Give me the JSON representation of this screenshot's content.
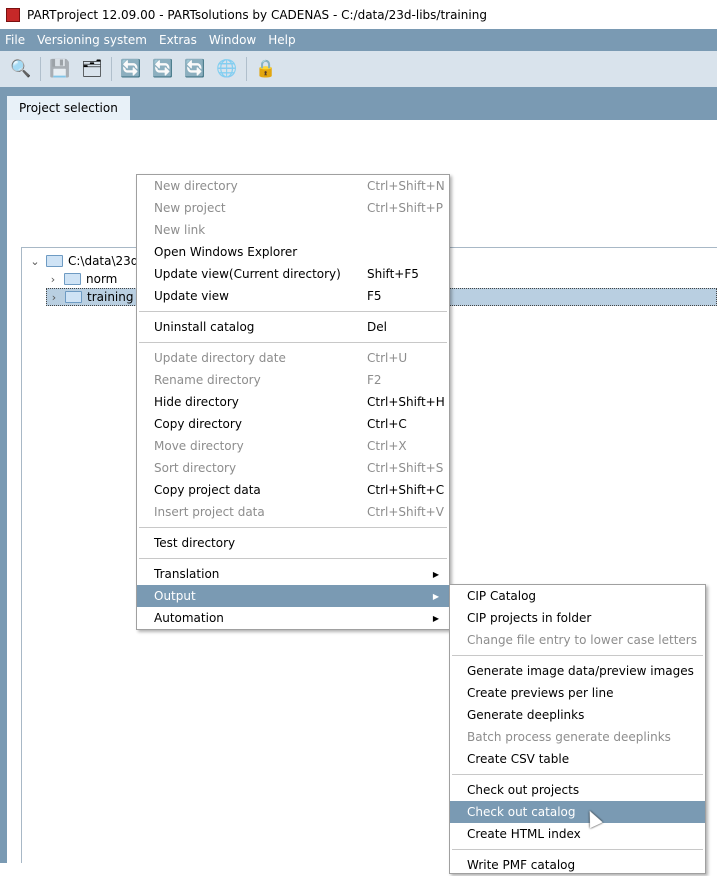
{
  "title": "PARTproject 12.09.00 - PARTsolutions by CADENAS - C:/data/23d-libs/training",
  "menubar": [
    "File",
    "Versioning system",
    "Extras",
    "Window",
    "Help"
  ],
  "toolbar": [
    "search-text-icon",
    "save-icon",
    "save-all-icon",
    "update-1-icon",
    "update-2-icon",
    "update-3-icon",
    "globe-icon",
    "lock-search-icon"
  ],
  "tab": "Project selection",
  "tree": {
    "root": "C:\\data\\23d-libs",
    "children": [
      "norm",
      "training"
    ]
  },
  "context_menu": [
    {
      "label": "New directory",
      "shortcut": "Ctrl+Shift+N",
      "disabled": true
    },
    {
      "label": "New project",
      "shortcut": "Ctrl+Shift+P",
      "disabled": true
    },
    {
      "label": "New link",
      "shortcut": "",
      "disabled": true
    },
    {
      "label": "Open Windows Explorer",
      "shortcut": ""
    },
    {
      "label": "Update view(Current directory)",
      "shortcut": "Shift+F5"
    },
    {
      "label": "Update view",
      "shortcut": "F5"
    },
    {
      "sep": true
    },
    {
      "label": "Uninstall catalog",
      "shortcut": "Del"
    },
    {
      "sep": true
    },
    {
      "label": "Update directory date",
      "shortcut": "Ctrl+U",
      "disabled": true
    },
    {
      "label": "Rename directory",
      "shortcut": "F2",
      "disabled": true
    },
    {
      "label": "Hide directory",
      "shortcut": "Ctrl+Shift+H"
    },
    {
      "label": "Copy directory",
      "shortcut": "Ctrl+C"
    },
    {
      "label": "Move directory",
      "shortcut": "Ctrl+X",
      "disabled": true
    },
    {
      "label": "Sort directory",
      "shortcut": "Ctrl+Shift+S",
      "disabled": true
    },
    {
      "label": "Copy project data",
      "shortcut": "Ctrl+Shift+C"
    },
    {
      "label": "Insert project data",
      "shortcut": "Ctrl+Shift+V",
      "disabled": true
    },
    {
      "sep": true
    },
    {
      "label": "Test directory",
      "shortcut": ""
    },
    {
      "sep": true
    },
    {
      "label": "Translation",
      "submenu": true
    },
    {
      "label": "Output",
      "submenu": true,
      "highlighted": true
    },
    {
      "label": "Automation",
      "submenu": true
    }
  ],
  "submenu": [
    {
      "label": "CIP Catalog"
    },
    {
      "label": "CIP projects in folder"
    },
    {
      "label": "Change file entry to lower case letters",
      "disabled": true
    },
    {
      "sep": true
    },
    {
      "label": "Generate image data/preview images"
    },
    {
      "label": "Create previews per line"
    },
    {
      "label": "Generate deeplinks"
    },
    {
      "label": "Batch process generate deeplinks",
      "disabled": true
    },
    {
      "label": "Create CSV table"
    },
    {
      "sep": true
    },
    {
      "label": "Check out projects"
    },
    {
      "label": "Check out catalog",
      "highlighted": true
    },
    {
      "label": "Create HTML index"
    },
    {
      "sep": true
    },
    {
      "label": "Write PMF catalog"
    }
  ]
}
